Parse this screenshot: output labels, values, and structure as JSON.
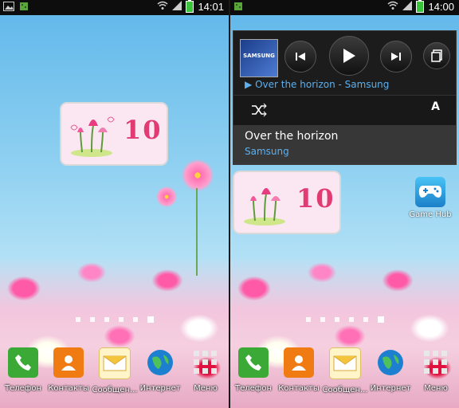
{
  "left_screen": {
    "status": {
      "time": "14:01"
    },
    "widget": {
      "number": "10"
    },
    "dock": [
      {
        "label": "Телефон",
        "icon": "phone-icon",
        "color": "#3aa935"
      },
      {
        "label": "Контакты",
        "icon": "contacts-icon",
        "color": "#f07b12"
      },
      {
        "label": "Сообщен...",
        "icon": "messages-icon",
        "color": "#f4c53a"
      },
      {
        "label": "Интернет",
        "icon": "globe-icon",
        "color": "#1d7fd0"
      },
      {
        "label": "Меню",
        "icon": "apps-grid-icon",
        "color": "#dddddd"
      }
    ]
  },
  "right_screen": {
    "status": {
      "time": "14:00"
    },
    "music_panel": {
      "album_text": "SAMSUNG",
      "now_playing": "Over the horizon - Samsung",
      "song_title": "Over the horizon",
      "song_artist": "Samsung",
      "repeat_label": "A"
    },
    "widget": {
      "number": "10"
    },
    "game_hub": {
      "label": "Game Hub"
    },
    "dock": [
      {
        "label": "Телефон",
        "icon": "phone-icon",
        "color": "#3aa935"
      },
      {
        "label": "Контакты",
        "icon": "contacts-icon",
        "color": "#f07b12"
      },
      {
        "label": "Сообщен...",
        "icon": "messages-icon",
        "color": "#f4c53a"
      },
      {
        "label": "Интернет",
        "icon": "globe-icon",
        "color": "#1d7fd0"
      },
      {
        "label": "Меню",
        "icon": "apps-grid-icon",
        "color": "#dddddd"
      }
    ]
  },
  "colors": {
    "accent_blue": "#5cb0ef",
    "widget_number": "#e23a73",
    "battery": "#39c439"
  }
}
